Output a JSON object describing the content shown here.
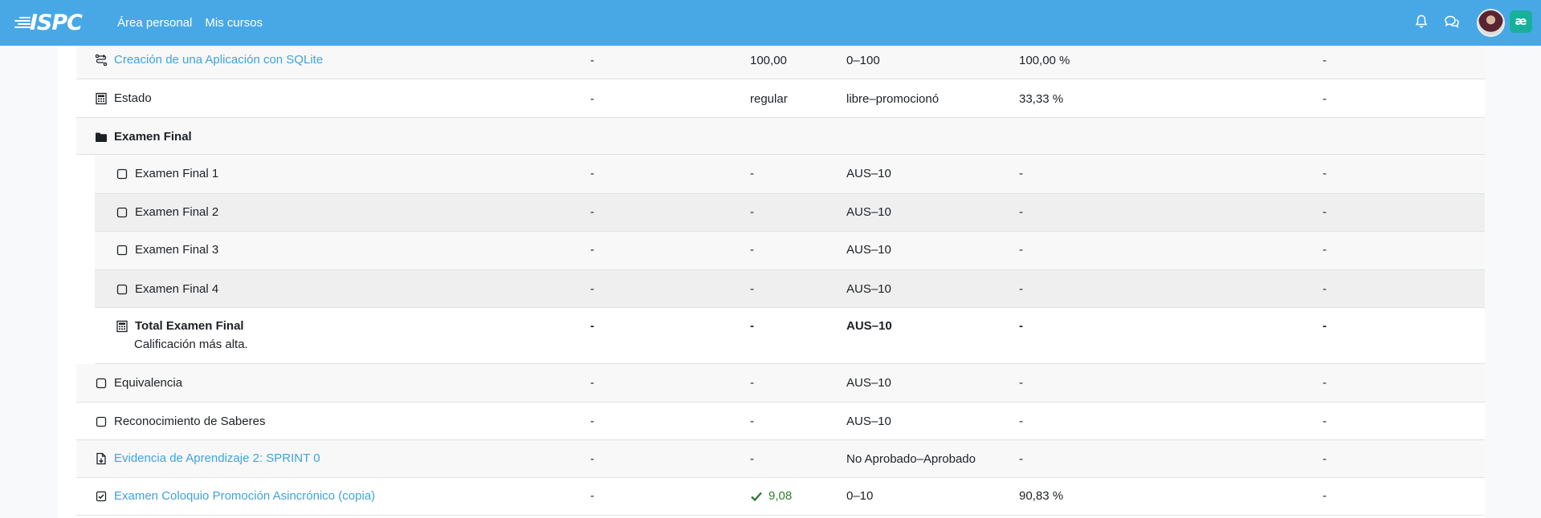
{
  "navbar": {
    "logo_text": "ISPC",
    "links": [
      "Área personal",
      "Mis cursos"
    ],
    "badge_text": "æ"
  },
  "rows": [
    {
      "name": "Creación de una Aplicación con SQLite",
      "icon": "aggregation-icon",
      "link": true,
      "c2": "-",
      "c3": "100,00",
      "c4": "0–100",
      "c5": "100,00 %",
      "c6": "-"
    },
    {
      "name": "Estado",
      "icon": "calculator-icon",
      "c2": "-",
      "c3": "regular",
      "c4": "libre–promocionó",
      "c5": "33,33 %",
      "c6": "-"
    },
    {
      "name": "Examen Final",
      "icon": "folder-icon",
      "category": true
    },
    {
      "name": "Examen Final 1",
      "icon": "square-icon",
      "c2": "-",
      "c3": "-",
      "c4": "AUS–10",
      "c5": "-",
      "c6": "-"
    },
    {
      "name": "Examen Final 2",
      "icon": "square-icon",
      "c2": "-",
      "c3": "-",
      "c4": "AUS–10",
      "c5": "-",
      "c6": "-"
    },
    {
      "name": "Examen Final 3",
      "icon": "square-icon",
      "c2": "-",
      "c3": "-",
      "c4": "AUS–10",
      "c5": "-",
      "c6": "-"
    },
    {
      "name": "Examen Final 4",
      "icon": "square-icon",
      "c2": "-",
      "c3": "-",
      "c4": "AUS–10",
      "c5": "-",
      "c6": "-"
    },
    {
      "name": "Total Examen Final",
      "icon": "calculator-icon",
      "subtitle": "Calificación más alta.",
      "c2": "-",
      "c3": "-",
      "c4": "AUS–10",
      "c5": "-",
      "c6": "-"
    },
    {
      "name": "Equivalencia",
      "icon": "square-icon",
      "c2": "-",
      "c3": "-",
      "c4": "AUS–10",
      "c5": "-",
      "c6": "-"
    },
    {
      "name": "Reconocimiento de Saberes",
      "icon": "square-icon",
      "c2": "-",
      "c3": "-",
      "c4": "AUS–10",
      "c5": "-",
      "c6": "-"
    },
    {
      "name": "Evidencia de Aprendizaje 2: SPRINT 0",
      "icon": "assignment-icon",
      "link": true,
      "c2": "-",
      "c3": "-",
      "c4": "No Aprobado–Aprobado",
      "c5": "-",
      "c6": "-"
    },
    {
      "name": "Examen Coloquio Promoción Asincrónico (copia)",
      "icon": "quiz-icon",
      "link": true,
      "c2": "-",
      "c3": "9,08",
      "c3_status": "check-icon",
      "c4": "0–10",
      "c5": "90,83 %",
      "c6": "-"
    }
  ],
  "colors": {
    "navbar": "#48a8e6",
    "link": "#3fa2dd",
    "ok": "#2e7d32"
  }
}
